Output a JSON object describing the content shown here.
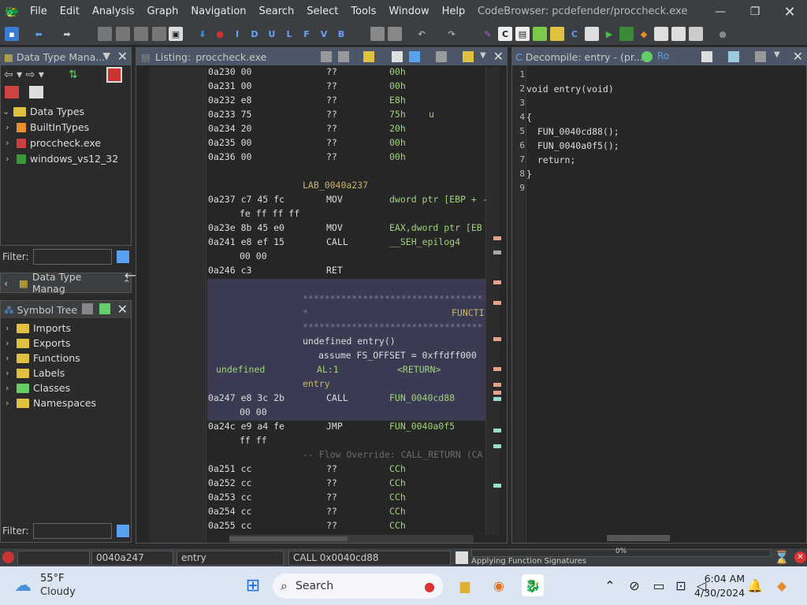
{
  "window": {
    "title": "CodeBrowser: pcdefender/proccheck.exe"
  },
  "menu": [
    "File",
    "Edit",
    "Analysis",
    "Graph",
    "Navigation",
    "Search",
    "Select",
    "Tools",
    "Window",
    "Help"
  ],
  "datatype_panel": {
    "title": "Data Type Mana...",
    "root": "Data Types",
    "items": [
      "BuiltInTypes",
      "proccheck.exe",
      "windows_vs12_32"
    ],
    "filter_label": "Filter:",
    "collapsed_title": "Data Type Manag"
  },
  "symbol_panel": {
    "title": "Symbol Tree",
    "items": [
      "Imports",
      "Exports",
      "Functions",
      "Labels",
      "Classes",
      "Namespaces"
    ],
    "filter_label": "Filter:"
  },
  "listing": {
    "tab_label": "Listing:",
    "tab_file": "proccheck.exe",
    "rows": [
      {
        "addr": "0a230",
        "bytes": "00",
        "mnem": "??",
        "op": "00h",
        "cmt": ""
      },
      {
        "addr": "0a231",
        "bytes": "00",
        "mnem": "??",
        "op": "00h",
        "cmt": ""
      },
      {
        "addr": "0a232",
        "bytes": "e8",
        "mnem": "??",
        "op": "E8h",
        "cmt": ""
      },
      {
        "addr": "0a233",
        "bytes": "75",
        "mnem": "??",
        "op": "75h",
        "cmt": "u"
      },
      {
        "addr": "0a234",
        "bytes": "20",
        "mnem": "??",
        "op": "20h",
        "cmt": ""
      },
      {
        "addr": "0a235",
        "bytes": "00",
        "mnem": "??",
        "op": "00h",
        "cmt": ""
      },
      {
        "addr": "0a236",
        "bytes": "00",
        "mnem": "??",
        "op": "00h",
        "cmt": ""
      }
    ],
    "label1": "LAB_0040a237",
    "rows2": [
      {
        "addr": "0a237",
        "bytes": "c7 45 fc",
        "mnem": "MOV",
        "op": "dword ptr [EBP + -"
      },
      {
        "addr": "",
        "bytes": "fe ff ff ff",
        "mnem": "",
        "op": ""
      },
      {
        "addr": "0a23e",
        "bytes": "8b 45 e0",
        "mnem": "MOV",
        "op": "EAX,dword ptr [EB"
      },
      {
        "addr": "0a241",
        "bytes": "e8 ef 15",
        "mnem": "CALL",
        "op": "__SEH_epilog4"
      },
      {
        "addr": "",
        "bytes": "00 00",
        "mnem": "",
        "op": ""
      },
      {
        "addr": "0a246",
        "bytes": "c3",
        "mnem": "RET",
        "op": ""
      }
    ],
    "stars": "****************************************",
    "func_label": "FUNCTI",
    "sig": "undefined entry()",
    "assume": "assume FS_OFFSET = 0xffdff000",
    "ret_type": "undefined",
    "ret_reg": "AL:1",
    "ret_tag": "<RETURN>",
    "entry_label": "entry",
    "rows3": [
      {
        "addr": "0a247",
        "bytes": "e8 3c 2b",
        "mnem": "CALL",
        "op": "FUN_0040cd88"
      },
      {
        "addr": "",
        "bytes": "00 00",
        "mnem": "",
        "op": ""
      },
      {
        "addr": "0a24c",
        "bytes": "e9 a4 fe",
        "mnem": "JMP",
        "op": "FUN_0040a0f5"
      },
      {
        "addr": "",
        "bytes": "ff ff",
        "mnem": "",
        "op": ""
      }
    ],
    "flow": "-- Flow Override: CALL_RETURN (CA",
    "rows4": [
      {
        "addr": "0a251",
        "bytes": "cc",
        "mnem": "??",
        "op": "CCh"
      },
      {
        "addr": "0a252",
        "bytes": "cc",
        "mnem": "??",
        "op": "CCh"
      },
      {
        "addr": "0a253",
        "bytes": "cc",
        "mnem": "??",
        "op": "CCh"
      },
      {
        "addr": "0a254",
        "bytes": "cc",
        "mnem": "??",
        "op": "CCh"
      },
      {
        "addr": "0a255",
        "bytes": "cc",
        "mnem": "??",
        "op": "CCh"
      }
    ]
  },
  "decompile": {
    "title": "Decompile: entry - (pr...",
    "lines": [
      "",
      "void entry(void)",
      "",
      "{",
      "  FUN_0040cd88();",
      "  FUN_0040a0f5();",
      "  return;",
      "}",
      ""
    ],
    "line_numbers": [
      "1",
      "2",
      "3",
      "4",
      "5",
      "6",
      "7",
      "8",
      "9"
    ]
  },
  "status": {
    "address": "0040a247",
    "function": "entry",
    "instruction": "CALL 0x0040cd88",
    "progress": "0%",
    "task": "Applying Function Signatures"
  },
  "taskbar": {
    "temp": "55°F",
    "weather": "Cloudy",
    "search": "Search",
    "time": "6:04 AM",
    "date": "4/30/2024"
  }
}
